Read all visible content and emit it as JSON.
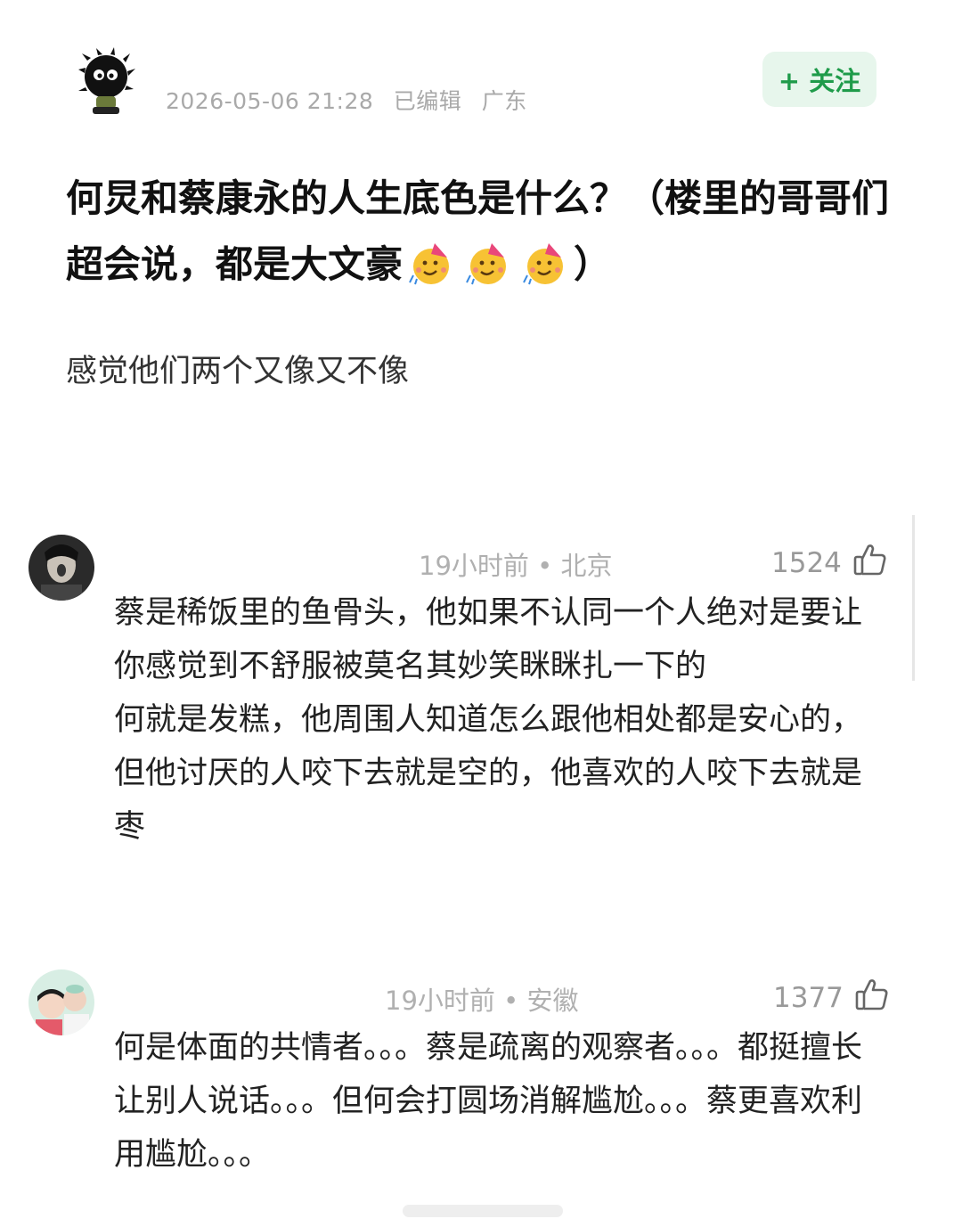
{
  "post": {
    "timestamp": "2026-05-06 21:28",
    "edited": "已编辑",
    "location": "广东",
    "follow_label": "+ 关注",
    "title_text": "何炅和蔡康永的人生底色是什么？（楼里的哥哥们超会说，都是大文豪",
    "title_tail": "）",
    "emoji_icon": "partying-face",
    "body": "感觉他们两个又像又不像"
  },
  "comments": [
    {
      "time": "19小时前",
      "location": "北京",
      "likes": "1524",
      "lines": [
        "蔡是稀饭里的鱼骨头，他如果不认同一个人绝对是要让你感觉到不舒服被莫名其妙笑眯眯扎一下的",
        "何就是发糕，他周围人知道怎么跟他相处都是安心的，但他讨厌的人咬下去就是空的，他喜欢的人咬下去就是枣"
      ]
    },
    {
      "time": "19小时前",
      "location": "安徽",
      "likes": "1377",
      "lines": [
        "何是体面的共情者。。。蔡是疏离的观察者。。。都挺擅长让别人说话。。。但何会打圆场消解尴尬。。。蔡更喜欢利用尴尬。。。"
      ]
    }
  ],
  "colors": {
    "follow_bg": "#e7f6ec",
    "follow_text": "#1f9b4a",
    "meta": "#a9a9a9"
  }
}
